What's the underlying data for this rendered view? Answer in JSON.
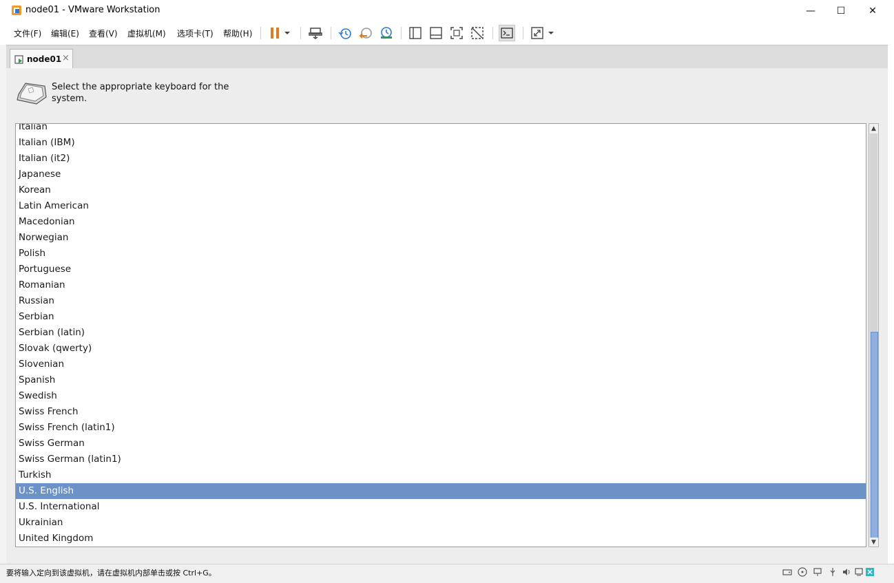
{
  "window": {
    "title": "node01 - VMware Workstation",
    "controls": {
      "minimize": "—",
      "maximize": "☐",
      "close": "✕"
    }
  },
  "menu": [
    "文件(F)",
    "编辑(E)",
    "查看(V)",
    "虚拟机(M)",
    "选项卡(T)",
    "帮助(H)"
  ],
  "toolbar_icons": [
    "pause-icon",
    "dropdown-arrow-icon",
    "send-ctrl-alt-del-icon",
    "snapshot-icon",
    "revert-snapshot-icon",
    "snapshot-manager-icon",
    "library-view-icon",
    "thumbnail-view-icon",
    "fullscreen-icon",
    "unity-icon",
    "console-view-icon",
    "autofit-icon",
    "autofit-dropdown-icon"
  ],
  "colors": {
    "accent_orange": "#e8761a",
    "selection_blue": "#6c92c8",
    "scroll_thumb": "#8fb0de"
  },
  "tab": {
    "label": "node01",
    "close": "×"
  },
  "installer": {
    "prompt": "Select the appropriate keyboard for the system.",
    "keyboards": [
      "Italian",
      "Italian (IBM)",
      "Italian (it2)",
      "Japanese",
      "Korean",
      "Latin American",
      "Macedonian",
      "Norwegian",
      "Polish",
      "Portuguese",
      "Romanian",
      "Russian",
      "Serbian",
      "Serbian (latin)",
      "Slovak (qwerty)",
      "Slovenian",
      "Spanish",
      "Swedish",
      "Swiss French",
      "Swiss French (latin1)",
      "Swiss German",
      "Swiss German (latin1)",
      "Turkish",
      "U.S. English",
      "U.S. International",
      "Ukrainian",
      "United Kingdom"
    ],
    "selected": "U.S. English",
    "scroll": {
      "thumb_start": 0.49,
      "thumb_size": 0.51
    }
  },
  "status": {
    "message": "要将输入定向到该虚拟机，请在虚拟机内部单击或按 Ctrl+G。"
  }
}
